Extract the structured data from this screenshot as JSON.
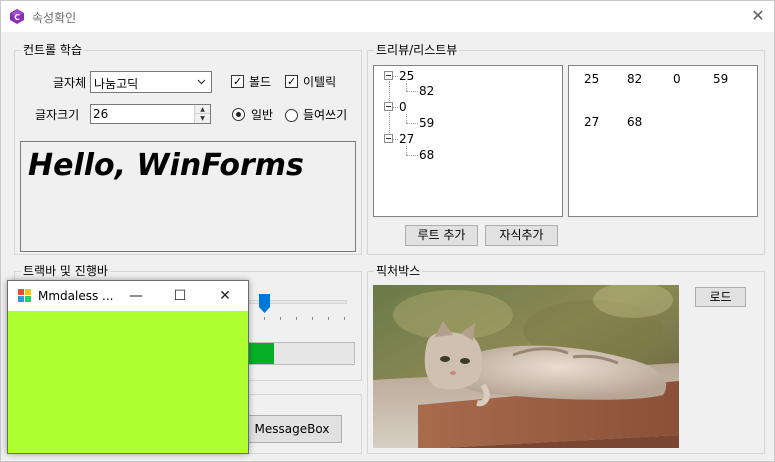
{
  "window": {
    "title": "속성확인",
    "close_glyph": "✕"
  },
  "group_controls": {
    "title": "컨트롤 학습",
    "font_label": "글자체",
    "font_value": "나눔고딕",
    "bold_label": "볼드",
    "bold_checked": true,
    "italic_label": "이텔릭",
    "italic_checked": true,
    "size_label": "글자크기",
    "size_value": "26",
    "normal_label": "일반",
    "normal_selected": true,
    "indent_label": "들여쓰기",
    "indent_selected": false,
    "sample_text": "Hello, WinForms"
  },
  "group_tree": {
    "title": "트리뷰/리스트뷰",
    "nodes": [
      {
        "label": "25",
        "child": "82"
      },
      {
        "label": "0",
        "child": "59"
      },
      {
        "label": "27",
        "child": "68"
      }
    ],
    "list_items": [
      [
        "25",
        "82",
        "0",
        "59"
      ],
      [
        "27",
        "68"
      ]
    ],
    "add_root_label": "루트 추가",
    "add_child_label": "자식추가"
  },
  "group_trackbar": {
    "title": "트랙바 및 진행바",
    "trackbar_value_fraction": 0.18,
    "progress_fraction": 0.27
  },
  "group_picture": {
    "title": "픽처박스",
    "load_label": "로드"
  },
  "group_message": {
    "messagebox_label": "MessageBox"
  },
  "popup": {
    "title": "Mmdaless ...",
    "minimize_glyph": "—",
    "maximize_glyph": "☐",
    "close_glyph": "✕",
    "client_color": "#adff2f"
  },
  "icons": {
    "app": "csharp-app-icon",
    "popup": "winforms-app-icon",
    "combo_arrow": "chevron-down-icon",
    "slider_thumb": "slider-thumb-icon"
  },
  "colors": {
    "progress_fill": "#06b025",
    "slider_thumb": "#0078d7",
    "popup_client": "#adff2f"
  }
}
